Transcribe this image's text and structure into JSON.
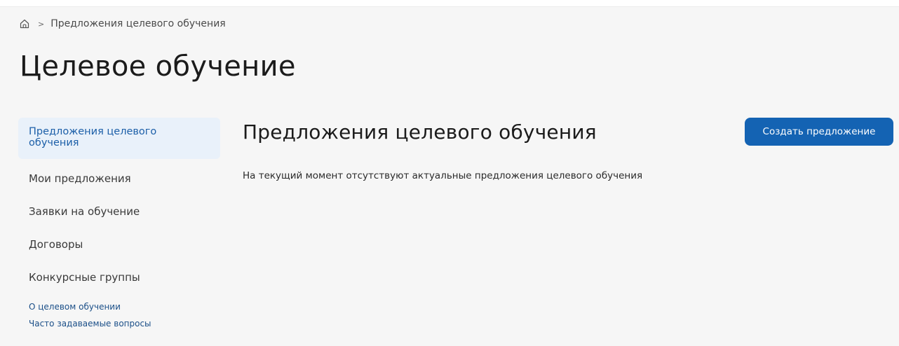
{
  "breadcrumb": {
    "home_icon": "home-icon",
    "separator": ">",
    "current": "Предложения целевого обучения"
  },
  "page": {
    "title": "Целевое обучение"
  },
  "sidebar": {
    "items": [
      {
        "label": "Предложения целевого обучения",
        "active": true
      },
      {
        "label": "Мои предложения",
        "active": false
      },
      {
        "label": "Заявки на обучение",
        "active": false
      },
      {
        "label": "Договоры",
        "active": false
      },
      {
        "label": "Конкурсные группы",
        "active": false
      }
    ],
    "links": [
      {
        "label": "О целевом обучении"
      },
      {
        "label": "Часто задаваемые вопросы"
      }
    ]
  },
  "main": {
    "title": "Предложения целевого обучения",
    "create_button_label": "Создать предложение",
    "empty_message": "На текущий момент отсутствуют актуальные предложения целевого обучения"
  },
  "colors": {
    "accent": "#1463b3",
    "active_bg": "#e9f1fa",
    "active_text": "#1c5fa8",
    "link": "#1b4f88",
    "page_bg": "#f6f6f6"
  }
}
